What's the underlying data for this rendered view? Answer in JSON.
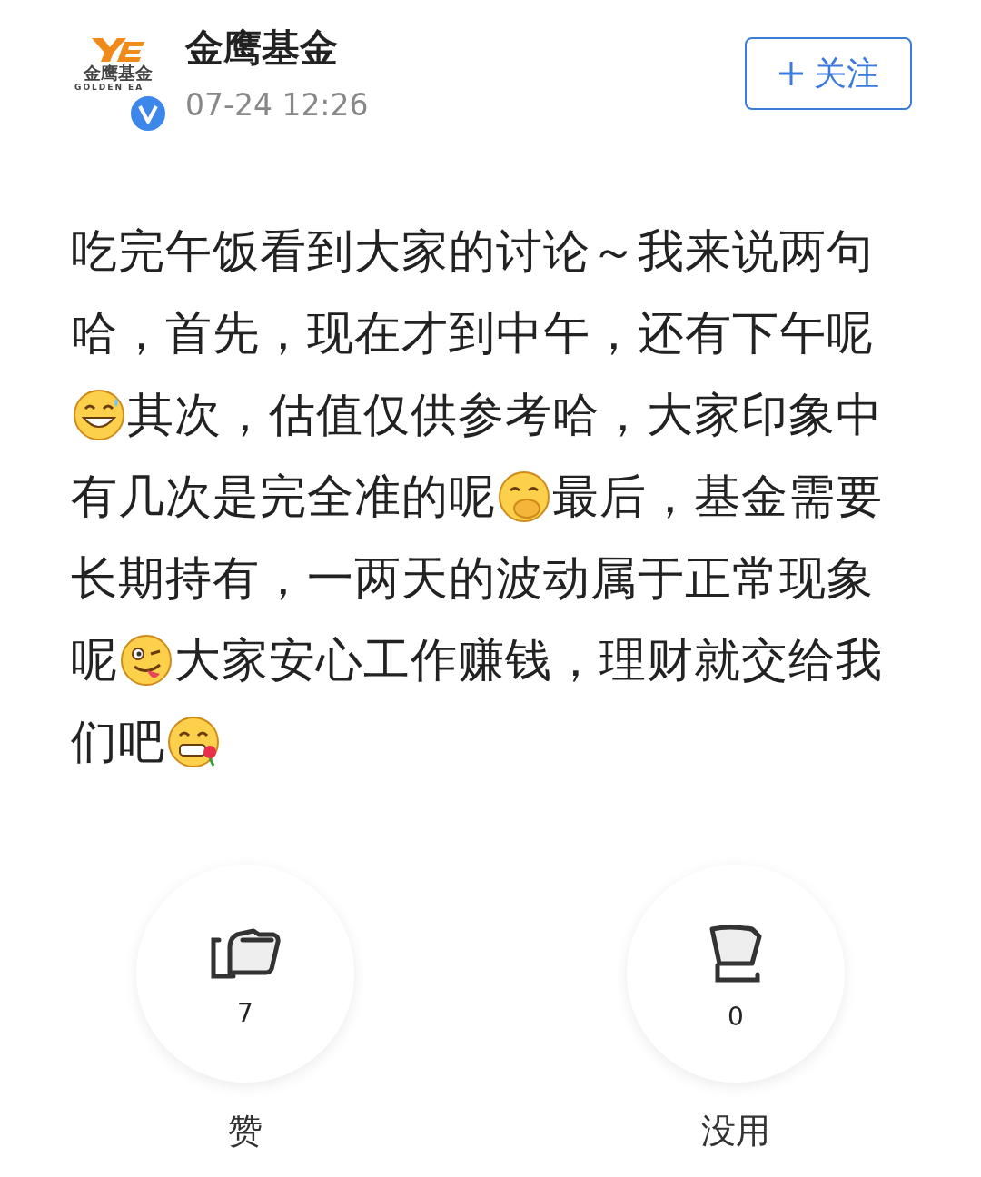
{
  "author": {
    "name": "金鹰基金",
    "verified": true,
    "time": "07-24 12:26",
    "logo": {
      "brand": "金鹰基金",
      "brand_en": "GOLDEN EA"
    }
  },
  "follow_button": {
    "label": "关注"
  },
  "post": [
    {
      "kind": "text",
      "text": "吃完午饭看到大家的讨论～我来说两句哈，首先，现在才到中午，还有下午呢"
    },
    {
      "kind": "emoji"
    },
    {
      "kind": "text",
      "text": "其次，估值仅供参考哈，大家印象中有几次是完全准的呢"
    },
    {
      "kind": "emoji"
    },
    {
      "kind": "text",
      "text": "最后，基金需要长期持有，一两天的波动属于正常现象呢"
    },
    {
      "kind": "emoji"
    },
    {
      "kind": "text",
      "text": "大家安心工作赚钱，理财就交给我们吧"
    },
    {
      "kind": "emoji"
    }
  ],
  "reactions": [
    {
      "kind": "like",
      "count": "7",
      "label": "赞"
    },
    {
      "kind": "useless",
      "count": "0",
      "label": "没用"
    }
  ]
}
